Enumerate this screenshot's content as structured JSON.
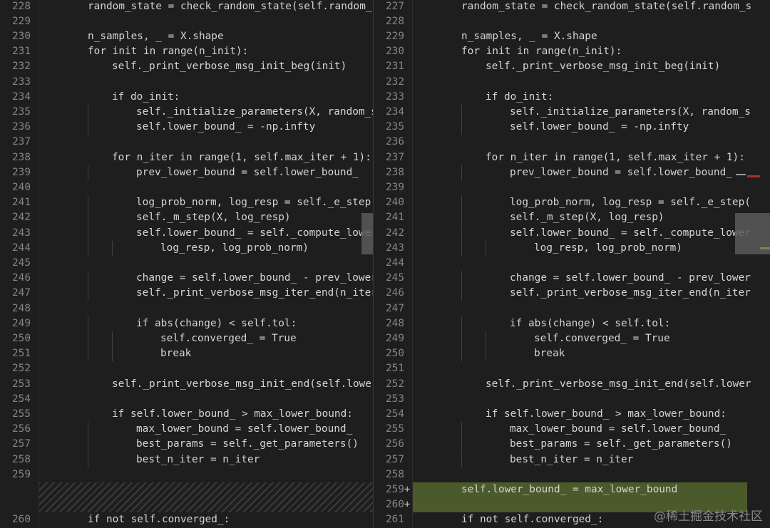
{
  "left_pane": {
    "lines": [
      {
        "num": "228",
        "text": "random_state = check_random_state(self.random_s",
        "indent": 2
      },
      {
        "num": "229",
        "text": "",
        "indent": 0
      },
      {
        "num": "230",
        "text": "n_samples, _ = X.shape",
        "indent": 2
      },
      {
        "num": "231",
        "text": "for init in range(n_init):",
        "indent": 2
      },
      {
        "num": "232",
        "text": "self._print_verbose_msg_init_beg(init)",
        "indent": 3
      },
      {
        "num": "233",
        "text": "",
        "indent": 0
      },
      {
        "num": "234",
        "text": "if do_init:",
        "indent": 3
      },
      {
        "num": "235",
        "text": "self._initialize_parameters(X, random_s",
        "indent": 4
      },
      {
        "num": "236",
        "text": "self.lower_bound_ = -np.infty",
        "indent": 4
      },
      {
        "num": "237",
        "text": "",
        "indent": 0
      },
      {
        "num": "238",
        "text": "for n_iter in range(1, self.max_iter + 1):",
        "indent": 3
      },
      {
        "num": "239",
        "text": "prev_lower_bound = self.lower_bound_",
        "indent": 4
      },
      {
        "num": "240",
        "text": "",
        "indent": 0
      },
      {
        "num": "241",
        "text": "log_prob_norm, log_resp = self._e_step(",
        "indent": 4
      },
      {
        "num": "242",
        "text": "self._m_step(X, log_resp)",
        "indent": 4
      },
      {
        "num": "243",
        "text": "self.lower_bound_ = self._compute_lower",
        "indent": 4
      },
      {
        "num": "244",
        "text": "log_resp, log_prob_norm)",
        "indent": 5
      },
      {
        "num": "245",
        "text": "",
        "indent": 0
      },
      {
        "num": "246",
        "text": "change = self.lower_bound_ - prev_lower",
        "indent": 4
      },
      {
        "num": "247",
        "text": "self._print_verbose_msg_iter_end(n_iter",
        "indent": 4
      },
      {
        "num": "248",
        "text": "",
        "indent": 0
      },
      {
        "num": "249",
        "text": "if abs(change) < self.tol:",
        "indent": 4
      },
      {
        "num": "250",
        "text": "self.converged_ = True",
        "indent": 5
      },
      {
        "num": "251",
        "text": "break",
        "indent": 5
      },
      {
        "num": "252",
        "text": "",
        "indent": 0
      },
      {
        "num": "253",
        "text": "self._print_verbose_msg_init_end(self.lower",
        "indent": 3
      },
      {
        "num": "254",
        "text": "",
        "indent": 0
      },
      {
        "num": "255",
        "text": "if self.lower_bound_ > max_lower_bound:",
        "indent": 3
      },
      {
        "num": "256",
        "text": "max_lower_bound = self.lower_bound_",
        "indent": 4
      },
      {
        "num": "257",
        "text": "best_params = self._get_parameters()",
        "indent": 4
      },
      {
        "num": "258",
        "text": "best_n_iter = n_iter",
        "indent": 4
      },
      {
        "num": "259",
        "text": "",
        "indent": 0
      },
      {
        "num": "",
        "text": "",
        "indent": 0,
        "filler": true
      },
      {
        "num": "",
        "text": "",
        "indent": 0,
        "filler": true
      },
      {
        "num": "260",
        "text": "if not self.converged_:",
        "indent": 2
      }
    ]
  },
  "right_pane": {
    "lines": [
      {
        "num": "227",
        "text": "random_state = check_random_state(self.random_s",
        "indent": 2
      },
      {
        "num": "228",
        "text": "",
        "indent": 0
      },
      {
        "num": "229",
        "text": "n_samples, _ = X.shape",
        "indent": 2
      },
      {
        "num": "230",
        "text": "for init in range(n_init):",
        "indent": 2
      },
      {
        "num": "231",
        "text": "self._print_verbose_msg_init_beg(init)",
        "indent": 3
      },
      {
        "num": "232",
        "text": "",
        "indent": 0
      },
      {
        "num": "233",
        "text": "if do_init:",
        "indent": 3
      },
      {
        "num": "234",
        "text": "self._initialize_parameters(X, random_s",
        "indent": 4
      },
      {
        "num": "235",
        "text": "self.lower_bound_ = -np.infty",
        "indent": 4
      },
      {
        "num": "236",
        "text": "",
        "indent": 0
      },
      {
        "num": "237",
        "text": "for n_iter in range(1, self.max_iter + 1):",
        "indent": 3
      },
      {
        "num": "238",
        "text": "prev_lower_bound = self.lower_bound_",
        "indent": 4
      },
      {
        "num": "239",
        "text": "",
        "indent": 0
      },
      {
        "num": "240",
        "text": "log_prob_norm, log_resp = self._e_step(",
        "indent": 4
      },
      {
        "num": "241",
        "text": "self._m_step(X, log_resp)",
        "indent": 4
      },
      {
        "num": "242",
        "text": "self.lower_bound_ = self._compute_lower",
        "indent": 4
      },
      {
        "num": "243",
        "text": "log_resp, log_prob_norm)",
        "indent": 5
      },
      {
        "num": "244",
        "text": "",
        "indent": 0
      },
      {
        "num": "245",
        "text": "change = self.lower_bound_ - prev_lower",
        "indent": 4
      },
      {
        "num": "246",
        "text": "self._print_verbose_msg_iter_end(n_iter",
        "indent": 4
      },
      {
        "num": "247",
        "text": "",
        "indent": 0
      },
      {
        "num": "248",
        "text": "if abs(change) < self.tol:",
        "indent": 4
      },
      {
        "num": "249",
        "text": "self.converged_ = True",
        "indent": 5
      },
      {
        "num": "250",
        "text": "break",
        "indent": 5
      },
      {
        "num": "251",
        "text": "",
        "indent": 0
      },
      {
        "num": "252",
        "text": "self._print_verbose_msg_init_end(self.lower",
        "indent": 3
      },
      {
        "num": "253",
        "text": "",
        "indent": 0
      },
      {
        "num": "254",
        "text": "if self.lower_bound_ > max_lower_bound:",
        "indent": 3
      },
      {
        "num": "255",
        "text": "max_lower_bound = self.lower_bound_",
        "indent": 4
      },
      {
        "num": "256",
        "text": "best_params = self._get_parameters()",
        "indent": 4
      },
      {
        "num": "257",
        "text": "best_n_iter = n_iter",
        "indent": 4
      },
      {
        "num": "258",
        "text": "",
        "indent": 0
      },
      {
        "num": "259",
        "text": "self.lower_bound_ = max_lower_bound",
        "indent": 2,
        "added": true,
        "marker": "+"
      },
      {
        "num": "260",
        "text": "",
        "indent": 0,
        "added": true,
        "marker": "+"
      },
      {
        "num": "261",
        "text": "if not self.converged_:",
        "indent": 2
      }
    ]
  },
  "colors": {
    "background": "#1e1e1e",
    "line_number": "#858585",
    "added_line": "#4b5a2a",
    "minimap_removed": "#b03030",
    "minimap_added": "#7a8a3a"
  },
  "watermark": "@稀土掘金技术社区"
}
